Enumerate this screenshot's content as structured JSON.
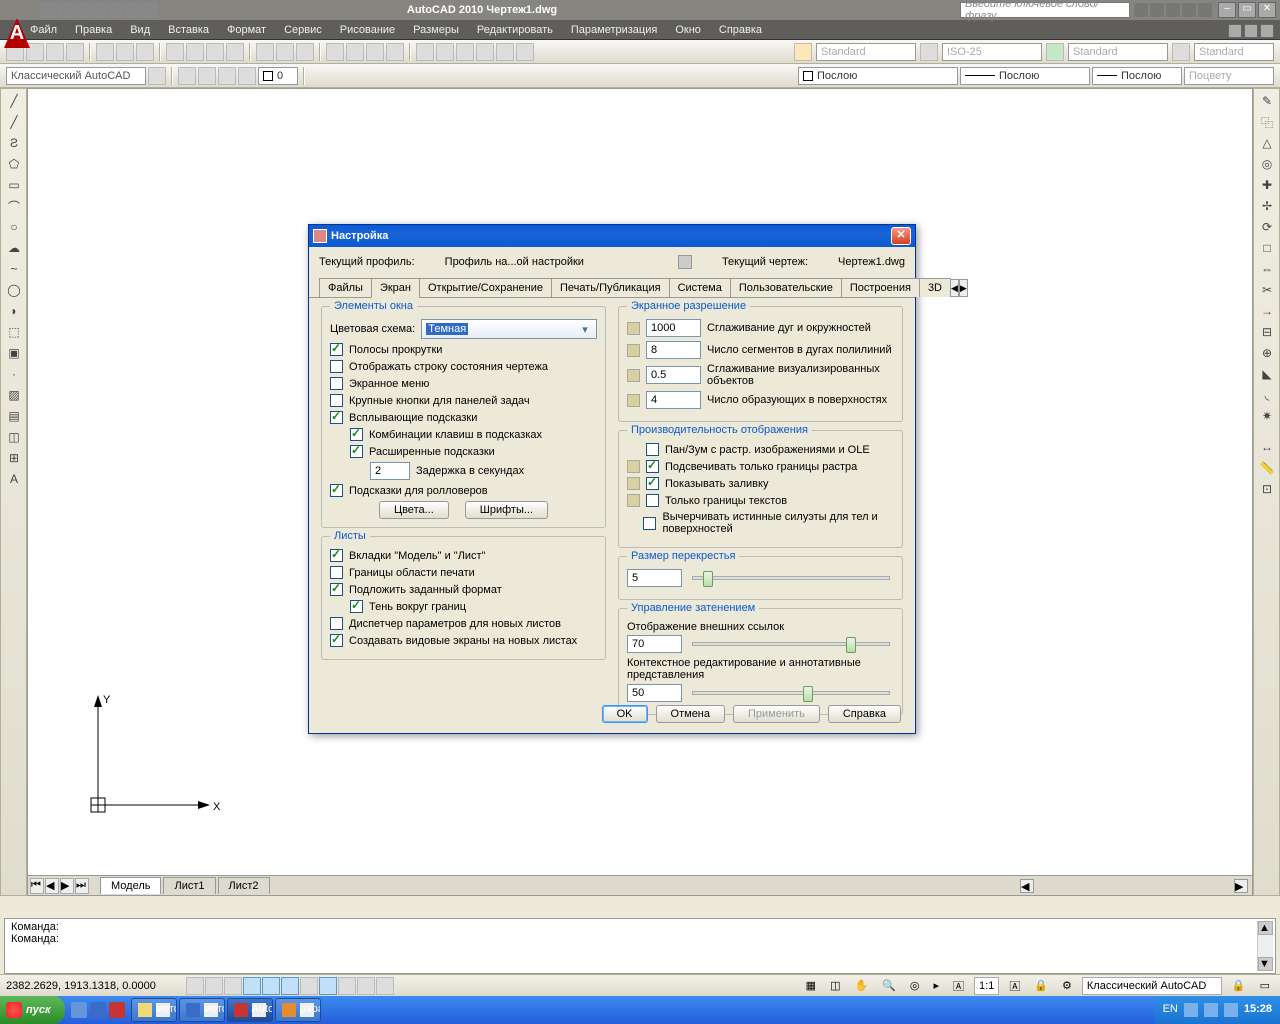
{
  "titlebar": {
    "title": "AutoCAD 2010   Чертеж1.dwg",
    "search_placeholder": "Введите ключевое слово/фразу"
  },
  "menubar": [
    "Файл",
    "Правка",
    "Вид",
    "Вставка",
    "Формат",
    "Сервис",
    "Рисование",
    "Размеры",
    "Редактировать",
    "Параметризация",
    "Окно",
    "Справка"
  ],
  "toolbar1": {
    "std": "Standard",
    "iso": "ISO-25",
    "std2": "Standard",
    "std3": "Standard"
  },
  "toolbar2": {
    "workspace": "Классический AutoCAD",
    "layer0": "0",
    "bylayer1": "Послою",
    "bylayer2": "Послою",
    "bylayer3": "Послою",
    "bycolor": "Поцвету"
  },
  "tabs": {
    "model": "Модель",
    "l1": "Лист1",
    "l2": "Лист2"
  },
  "cmd": {
    "l1": "Команда:",
    "l2": "Команда:"
  },
  "statusbar": {
    "coords": "2382.2629, 1913.1318, 0.0000",
    "ratio": "1:1",
    "ws": "Классический AutoCAD"
  },
  "taskbar": {
    "start": "пуск",
    "t1": "методичка для курсов",
    "t2": "методичка по AutoC...",
    "t3": "AutoCAD 2010 - [Чер...",
    "t4": "papa74 — «Немо уж...",
    "lang": "EN",
    "clock": "15:28"
  },
  "dialog": {
    "title": "Настройка",
    "profile_lbl": "Текущий профиль:",
    "profile_val": "Профиль на...ой настройки",
    "drawing_lbl": "Текущий чертеж:",
    "drawing_val": "Чертеж1.dwg",
    "tabs": [
      "Файлы",
      "Экран",
      "Открытие/Сохранение",
      "Печать/Публикация",
      "Система",
      "Пользовательские",
      "Построения",
      "3D"
    ],
    "grp_window": "Элементы окна",
    "colorscheme_lbl": "Цветовая схема:",
    "colorscheme_val": "Темная",
    "scrollbars": "Полосы прокрутки",
    "statusline": "Отображать строку состояния чертежа",
    "screenmenu": "Экранное меню",
    "bigbuttons": "Крупные кнопки для панелей задач",
    "tooltips": "Всплывающие подсказки",
    "shortcuts": "Комбинации клавиш в подсказках",
    "extended": "Расширенные подсказки",
    "delay_val": "2",
    "delay_lbl": "Задержка в секундах",
    "rollover": "Подсказки для ролловеров",
    "btn_colors": "Цвета...",
    "btn_fonts": "Шрифты...",
    "grp_sheets": "Листы",
    "sh1": "Вкладки \"Модель\" и \"Лист\"",
    "sh2": "Границы области печати",
    "sh3": "Подложить заданный формат",
    "sh4": "Тень вокруг границ",
    "sh5": "Диспетчер параметров для новых листов",
    "sh6": "Создавать видовые экраны на новых листах",
    "grp_res": "Экранное разрешение",
    "r1v": "1000",
    "r1l": "Сглаживание дуг и окружностей",
    "r2v": "8",
    "r2l": "Число сегментов в дугах полилиний",
    "r3v": "0.5",
    "r3l": "Сглаживание визуализированных объектов",
    "r4v": "4",
    "r4l": "Число образующих в поверхностях",
    "grp_perf": "Производительность отображения",
    "p1": "Пан/Зум с растр. изображениями и OLE",
    "p2": "Подсвечивать только границы растра",
    "p3": "Показывать заливку",
    "p4": "Только границы текстов",
    "p5": "Вычерчивать истинные силуэты для тел и поверхностей",
    "grp_cross": "Размер перекрестья",
    "cross_v": "5",
    "grp_dim": "Управление затенением",
    "dim1_lbl": "Отображение внешних ссылок",
    "dim1_v": "70",
    "dim2_lbl": "Контекстное редактирование и аннотативные представления",
    "dim2_v": "50",
    "ok": "OK",
    "cancel": "Отмена",
    "apply": "Применить",
    "help": "Справка"
  }
}
